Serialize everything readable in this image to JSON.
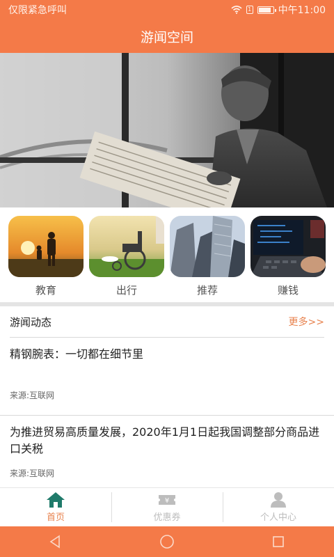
{
  "status_bar": {
    "left_text": "仅限紧急呼叫",
    "time": "中午11:00",
    "sim_label": "1",
    "battery_level": 0.85
  },
  "header": {
    "title": "游闻空间"
  },
  "banner": {
    "image": "man-reading-newspaper-statue"
  },
  "categories": [
    {
      "label": "教育",
      "image": "father-child-sunset"
    },
    {
      "label": "出行",
      "image": "wheelchair-grass"
    },
    {
      "label": "推荐",
      "image": "skyscrapers"
    },
    {
      "label": "赚钱",
      "image": "laptop-typing"
    }
  ],
  "news_section": {
    "title": "游闻动态",
    "more_label": "更多>>",
    "items": [
      {
        "title": "精钢腕表：一切都在细节里",
        "source": "来源:互联网"
      },
      {
        "title": "为推进贸易高质量发展，2020年1月1日起我国调整部分商品进口关税",
        "source": "来源:互联网"
      }
    ]
  },
  "tab_bar": {
    "tabs": [
      {
        "label": "首页",
        "icon": "home-icon",
        "active": true
      },
      {
        "label": "优惠券",
        "icon": "coupon-icon",
        "active": false
      },
      {
        "label": "个人中心",
        "icon": "person-icon",
        "active": false
      }
    ]
  },
  "nav_bar": {
    "buttons": [
      "back-icon",
      "home-circle-icon",
      "recent-apps-icon"
    ]
  },
  "colors": {
    "accent": "#f47a48",
    "link": "#e8834f",
    "inactive": "#bdbdbd",
    "home_icon": "#1f7a6a"
  }
}
